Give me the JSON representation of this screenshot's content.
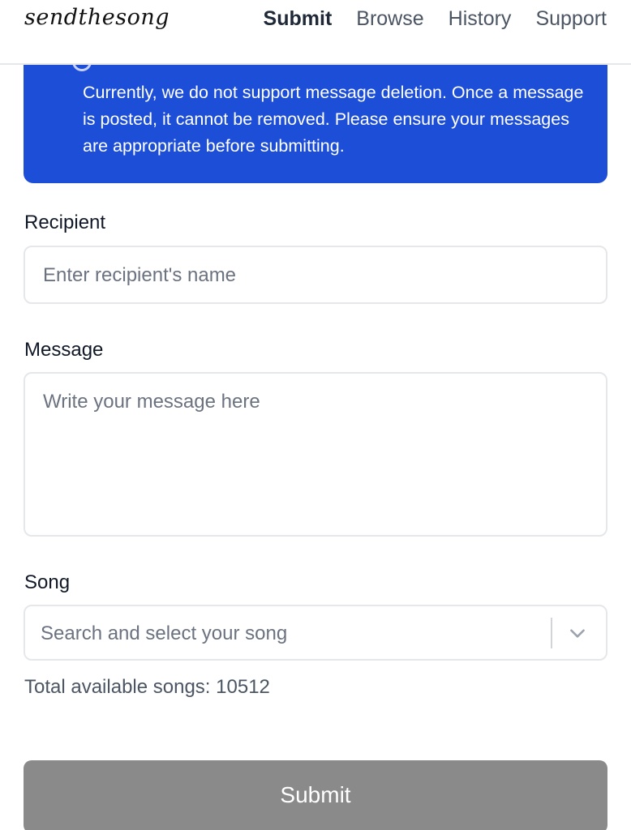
{
  "header": {
    "logo": "sendthesong",
    "nav": [
      {
        "label": "Submit",
        "active": true
      },
      {
        "label": "Browse",
        "active": false
      },
      {
        "label": "History",
        "active": false
      },
      {
        "label": "Support",
        "active": false
      }
    ]
  },
  "banner": {
    "text": "Currently, we do not support message deletion. Once a message is posted, it cannot be removed. Please ensure your messages are appropriate before submitting.",
    "color": "#1d4ed8"
  },
  "form": {
    "recipient": {
      "label": "Recipient",
      "placeholder": "Enter recipient's name"
    },
    "message": {
      "label": "Message",
      "placeholder": "Write your message here"
    },
    "song": {
      "label": "Song",
      "placeholder": "Search and select your song"
    },
    "songs_count": "Total available songs: 10512",
    "submit_label": "Submit"
  }
}
